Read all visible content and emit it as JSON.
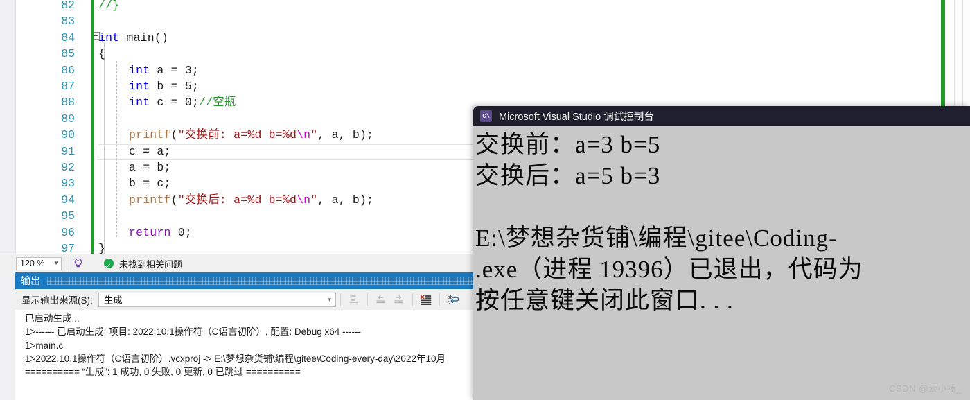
{
  "editor": {
    "language": "C",
    "zoom_level": "120 %",
    "status_message": "未找到相关问题",
    "current_line_number": 91,
    "lines": [
      {
        "number": "82",
        "indent": 0,
        "changed": true,
        "tokens": [
          {
            "t": "//}",
            "c": "cmt"
          }
        ]
      },
      {
        "number": "83",
        "indent": 0,
        "changed": true,
        "tokens": []
      },
      {
        "number": "84",
        "indent": 0,
        "changed": true,
        "tokens": [
          {
            "t": "int",
            "c": "kw"
          },
          {
            "t": " main()",
            "c": "plain"
          }
        ]
      },
      {
        "number": "85",
        "indent": 0,
        "changed": true,
        "tokens": [
          {
            "t": "{",
            "c": "plain"
          }
        ]
      },
      {
        "number": "86",
        "indent": 1,
        "changed": true,
        "tokens": [
          {
            "t": "int",
            "c": "kw"
          },
          {
            "t": " a = 3;",
            "c": "plain"
          }
        ]
      },
      {
        "number": "87",
        "indent": 1,
        "changed": true,
        "tokens": [
          {
            "t": "int",
            "c": "kw"
          },
          {
            "t": " b = 5;",
            "c": "plain"
          }
        ]
      },
      {
        "number": "88",
        "indent": 1,
        "changed": true,
        "tokens": [
          {
            "t": "int",
            "c": "kw"
          },
          {
            "t": " c = 0;",
            "c": "plain"
          },
          {
            "t": "//空瓶",
            "c": "cmt"
          }
        ]
      },
      {
        "number": "89",
        "indent": 1,
        "changed": true,
        "tokens": []
      },
      {
        "number": "90",
        "indent": 1,
        "changed": true,
        "tokens": [
          {
            "t": "printf",
            "c": "fn"
          },
          {
            "t": "(",
            "c": "plain"
          },
          {
            "t": "\"交换前: a=%d b=%d",
            "c": "str"
          },
          {
            "t": "\\n",
            "c": "esc"
          },
          {
            "t": "\"",
            "c": "str"
          },
          {
            "t": ", a, b);",
            "c": "plain"
          }
        ]
      },
      {
        "number": "91",
        "indent": 1,
        "changed": true,
        "tokens": [
          {
            "t": "c = a;",
            "c": "plain"
          }
        ]
      },
      {
        "number": "92",
        "indent": 1,
        "changed": true,
        "tokens": [
          {
            "t": "a = b;",
            "c": "plain"
          }
        ]
      },
      {
        "number": "93",
        "indent": 1,
        "changed": true,
        "tokens": [
          {
            "t": "b = c;",
            "c": "plain"
          }
        ]
      },
      {
        "number": "94",
        "indent": 1,
        "changed": true,
        "tokens": [
          {
            "t": "printf",
            "c": "fn"
          },
          {
            "t": "(",
            "c": "plain"
          },
          {
            "t": "\"交换后: a=%d b=%d",
            "c": "str"
          },
          {
            "t": "\\n",
            "c": "esc"
          },
          {
            "t": "\"",
            "c": "str"
          },
          {
            "t": ", a, b);",
            "c": "plain"
          }
        ]
      },
      {
        "number": "95",
        "indent": 1,
        "changed": true,
        "tokens": []
      },
      {
        "number": "96",
        "indent": 1,
        "changed": true,
        "tokens": [
          {
            "t": "return",
            "c": "kw2"
          },
          {
            "t": " 0;",
            "c": "plain"
          }
        ]
      },
      {
        "number": "97",
        "indent": 0,
        "changed": true,
        "tokens": [
          {
            "t": "}",
            "c": "plain"
          }
        ]
      }
    ]
  },
  "output_panel": {
    "title": "输出",
    "source_label": "显示输出来源(S):",
    "source_value": "生成",
    "toolbar_icons": [
      "pin-output-icon",
      "navigate-back-icon",
      "navigate-forward-icon",
      "clear-all-icon",
      "toggle-word-wrap-icon"
    ],
    "lines": [
      "已启动生成...",
      "1>------ 已启动生成: 项目: 2022.10.1操作符（C语言初阶）, 配置: Debug x64 ------",
      "1>main.c",
      "1>2022.10.1操作符（C语言初阶）.vcxproj -> E:\\梦想杂货铺\\编程\\gitee\\Coding-every-day\\2022年10月",
      "========== “生成”: 1 成功, 0 失败, 0 更新, 0 已跳过 =========="
    ]
  },
  "console_window": {
    "title": "Microsoft Visual Studio 调试控制台",
    "icon": "console-app-icon",
    "icon_glyph": "C\\",
    "lines": [
      "交换前：a=3 b=5",
      "交换后：a=5 b=3",
      "",
      "E:\\梦想杂货铺\\编程\\gitee\\Coding-",
      ".exe（进程 19396）已退出，代码为",
      "按任意键关闭此窗口. . ."
    ]
  },
  "watermark": {
    "text": "CSDN @云小扬_"
  },
  "colors": {
    "accent_blue": "#1a7bc4",
    "change_bar_green": "#1f9c28",
    "console_bg": "#c8c8c8",
    "console_titlebar": "#1f1f2e",
    "keyword_blue": "#0000ff",
    "string_red": "#a31515",
    "comment_green": "#1f9c28",
    "linenumber_teal": "#2b91af"
  }
}
